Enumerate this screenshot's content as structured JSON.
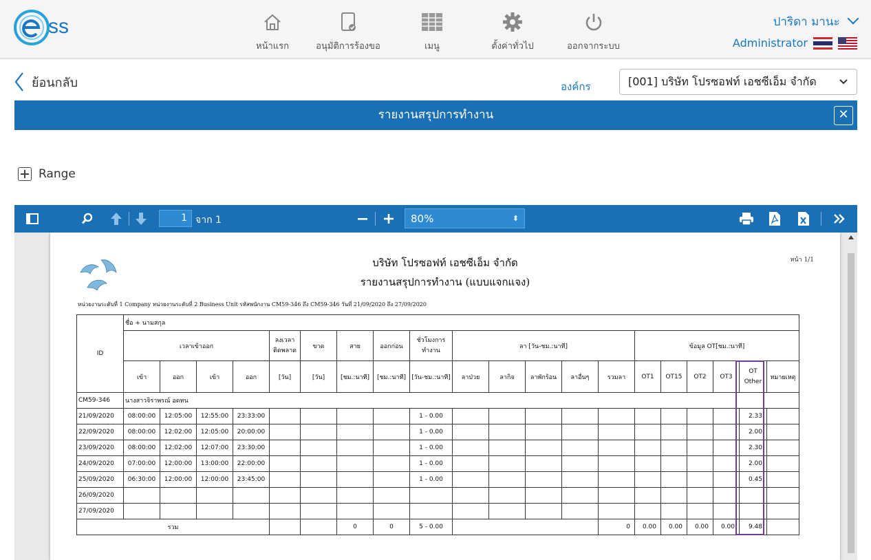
{
  "app": {
    "logo_text": "ss"
  },
  "nav": [
    {
      "label": "หน้าแรก",
      "icon": "home-icon"
    },
    {
      "label": "อนุมัติการร้องขอ",
      "icon": "approve-doc-icon"
    },
    {
      "label": "เมนู",
      "icon": "menu-grid-icon"
    },
    {
      "label": "ตั้งค่าทั่วไป",
      "icon": "gear-icon"
    },
    {
      "label": "ออกจากระบบ",
      "icon": "power-icon"
    }
  ],
  "user": {
    "name": "ปาริดา มานะ",
    "role": "Administrator"
  },
  "back_label": "ย้อนกลับ",
  "org": {
    "label": "องค์กร",
    "selected": "[001] บริษัท โปรซอฟท์ เอชซีเอ็ม จำกัด"
  },
  "page_title": "รายงานสรุปการทำงาน",
  "range_label": "Range",
  "viewer": {
    "page": "1",
    "of_label": "จาก 1",
    "zoom": "80%"
  },
  "report": {
    "company": "บริษัท โปรซอฟท์ เอชซีเอ็ม จำกัด",
    "title": "รายงานสรุปการทำงาน (แบบแจกแจง)",
    "page_no": "หน้า 1/1",
    "filter": "หน่วยงานระดับที่ 1 Company หน่วยงานระดับที่ 2 Business Unit รหัสพนักงาน CM59-346 ถึง CM59-346 วันที่ 21/09/2020 ถึง 27/09/2020",
    "h_id": "ID",
    "h_name": "ชื่อ + นามสกุล",
    "h_inout": "เวลาเข้าออก",
    "h_forgot": "ลงเวลาติดพลาด",
    "h_absent": "ขาด",
    "h_late": "สาย",
    "h_early": "ออกก่อน",
    "h_hours": "ชั่วโมงการทำงาน",
    "h_leave": "ลา [วัน-ชม.:นาที]",
    "h_ot": "ข้อมูล OT[ชม.:นาที]",
    "sub": {
      "in1": "เข้า",
      "out1": "ออก",
      "in2": "เข้า",
      "out2": "ออก",
      "day1": "[วัน]",
      "day2": "[วัน]",
      "hm1": "[ชม.:นาที]",
      "hm2": "[ชม.:นาที]",
      "dhm": "[วัน-ชม.:นาที]",
      "sick": "ลาป่วย",
      "business": "ลากิจ",
      "vacation": "ลาพักร้อน",
      "other": "ลาอื่นๆ",
      "total_leave": "รวมลา",
      "ot1": "OT1",
      "ot15": "OT15",
      "ot2": "OT2",
      "ot3": "OT3",
      "ot_other": "OT Other",
      "remark": "หมายเหตุ"
    },
    "employee": {
      "id": "CM59-346",
      "name": "นางสาวจิราพรณ์ อดทน"
    },
    "rows": [
      {
        "date": "21/09/2020",
        "in1": "08:00:00",
        "out1": "12:05:00",
        "in2": "12:55:00",
        "out2": "23:33:00",
        "hours": "1 - 0.00",
        "ot_other": "2.33"
      },
      {
        "date": "22/09/2020",
        "in1": "08:00:00",
        "out1": "12:02:00",
        "in2": "12:05:00",
        "out2": "20:00:00",
        "hours": "1 - 0.00",
        "ot_other": "2.00"
      },
      {
        "date": "23/09/2020",
        "in1": "08:00:00",
        "out1": "12:02:00",
        "in2": "12:07:00",
        "out2": "23:30:00",
        "hours": "1 - 0.00",
        "ot_other": "2.30"
      },
      {
        "date": "24/09/2020",
        "in1": "07:00:00",
        "out1": "12:00:00",
        "in2": "13:00:00",
        "out2": "22:00:00",
        "hours": "1 - 0.00",
        "ot_other": "2.00"
      },
      {
        "date": "25/09/2020",
        "in1": "06:30:00",
        "out1": "12:00:00",
        "in2": "12:00:00",
        "out2": "23:45:00",
        "hours": "1 - 0.00",
        "ot_other": "0.45"
      },
      {
        "date": "26/09/2020",
        "in1": "",
        "out1": "",
        "in2": "",
        "out2": "",
        "hours": "",
        "ot_other": ""
      },
      {
        "date": "27/09/2020",
        "in1": "",
        "out1": "",
        "in2": "",
        "out2": "",
        "hours": "",
        "ot_other": ""
      }
    ],
    "total": {
      "label": "รวม",
      "late": "0",
      "early": "0",
      "hours": "5 - 0.00",
      "leave": "0",
      "ot1": "0.00",
      "ot15": "0.00",
      "ot2": "0.00",
      "ot3": "0.00",
      "ot_other": "9.48"
    }
  },
  "colors": {
    "brand_blue": "#1a6fb5",
    "link_blue": "#1a78c2",
    "highlight": "#6a3d9a"
  }
}
